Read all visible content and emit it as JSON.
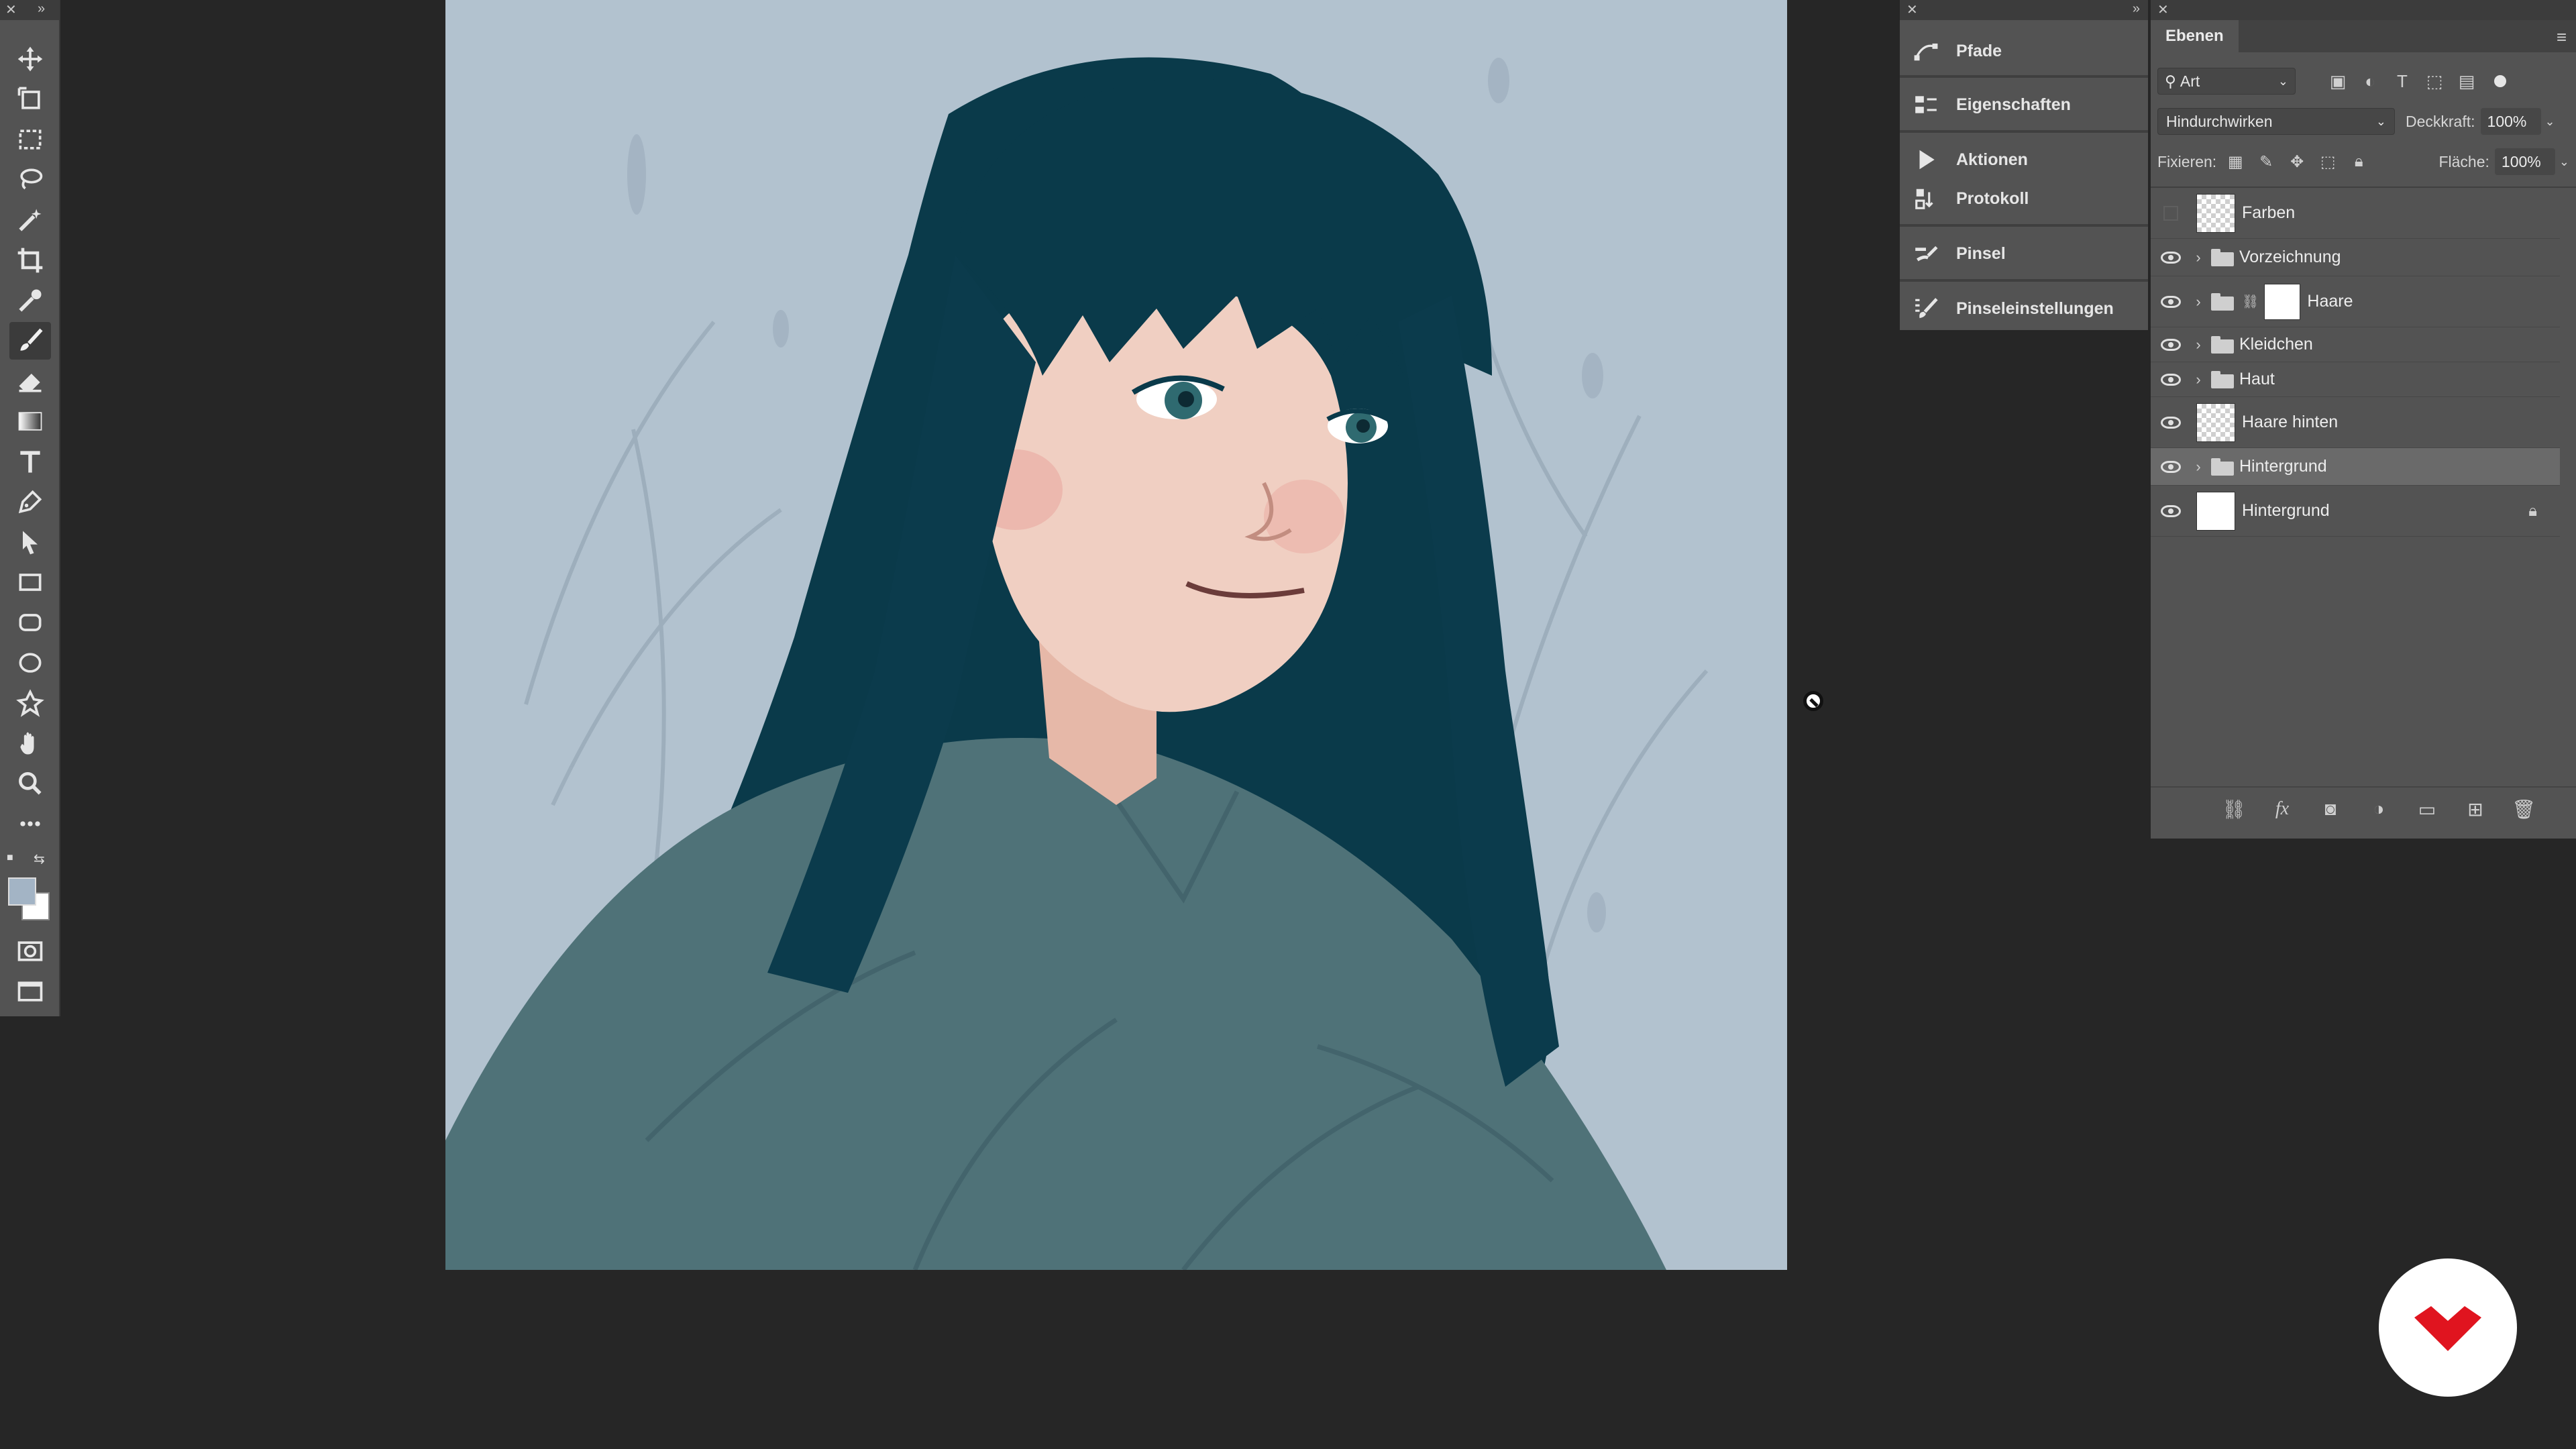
{
  "mid_panel": {
    "items": [
      {
        "label": "Pfade",
        "icon": "paths-icon"
      },
      {
        "label": "Eigenschaften",
        "icon": "properties-icon"
      },
      {
        "label": "Aktionen",
        "icon": "play-icon"
      },
      {
        "label": "Protokoll",
        "icon": "history-icon"
      },
      {
        "label": "Pinsel",
        "icon": "brush-icon"
      },
      {
        "label": "Pinseleinstellungen",
        "icon": "brush-settings-icon"
      }
    ]
  },
  "layers_panel": {
    "tab_label": "Ebenen",
    "filter_kind": "Art",
    "blend_mode": "Hindurchwirken",
    "opacity_label": "Deckkraft:",
    "opacity_value": "100%",
    "lock_label": "Fixieren:",
    "fill_label": "Fläche:",
    "fill_value": "100%",
    "layers": [
      {
        "name": "Farben",
        "visible": false,
        "type": "layer"
      },
      {
        "name": "Vorzeichnung",
        "visible": true,
        "type": "group"
      },
      {
        "name": "Haare",
        "visible": true,
        "type": "group-masked"
      },
      {
        "name": "Kleidchen",
        "visible": true,
        "type": "group"
      },
      {
        "name": "Haut",
        "visible": true,
        "type": "group"
      },
      {
        "name": "Haare hinten",
        "visible": true,
        "type": "layer"
      },
      {
        "name": "Hintergrund",
        "visible": true,
        "type": "group",
        "selected": true
      },
      {
        "name": "Hintergrund",
        "visible": true,
        "type": "background",
        "locked": true
      }
    ]
  },
  "tools": [
    "move-tool",
    "artboard-tool",
    "marquee-tool",
    "lasso-tool",
    "magic-wand-tool",
    "crop-tool",
    "eyedropper-tool",
    "brush-tool",
    "eraser-tool",
    "gradient-tool",
    "type-tool",
    "pen-tool",
    "path-selection-tool",
    "rectangle-tool",
    "rounded-rectangle-tool",
    "ellipse-tool",
    "custom-shape-tool",
    "hand-tool",
    "zoom-tool",
    "more-tools"
  ],
  "colors": {
    "foreground": "#a3b4c5",
    "background": "#ffffff",
    "canvas_bg": "#b2c2cf",
    "hair": "#0a3a4a",
    "dress": "#4f7278",
    "skin": "#f0cfc2",
    "logo_red": "#e0141f"
  }
}
